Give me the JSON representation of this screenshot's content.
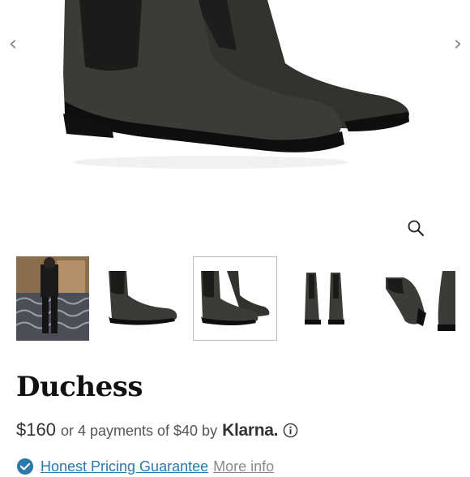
{
  "product": {
    "name": "Duchess",
    "price": "$160",
    "installment_text": "or 4 payments of $40 by",
    "klarna_label": "Klarna.",
    "guarantee_link": "Honest Pricing Guarantee",
    "more_info": "More info"
  },
  "gallery": {
    "prev_arrow": "‹",
    "next_arrow": "›",
    "thumbnail_count": 5,
    "selected_thumbnail": 3
  },
  "icons": {
    "prev": "chevron-left-icon",
    "next": "chevron-right-icon",
    "zoom": "zoom-icon",
    "info": "info-icon",
    "check": "check-circle-icon"
  },
  "colors": {
    "boot": "#3b3935",
    "sole": "#111111",
    "link": "#2a79a8",
    "check_bg": "#2a79a8",
    "muted": "#8a8a8a"
  }
}
